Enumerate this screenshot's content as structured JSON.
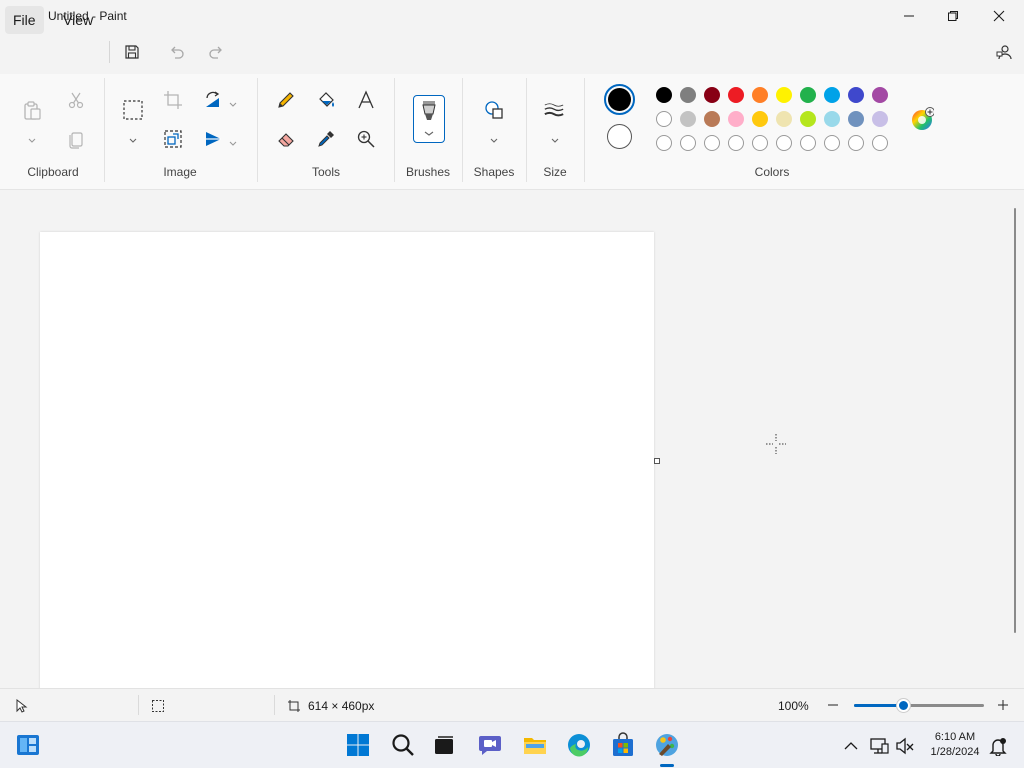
{
  "window": {
    "title": "Untitled - Paint"
  },
  "menu": {
    "file": "File",
    "view": "View"
  },
  "ribbon": {
    "groups": {
      "clipboard": "Clipboard",
      "image": "Image",
      "tools": "Tools",
      "brushes": "Brushes",
      "shapes": "Shapes",
      "size": "Size",
      "colors": "Colors"
    },
    "primary_color": "#000000",
    "secondary_color": "#ffffff",
    "palette_row1": [
      "#000000",
      "#7f7f7f",
      "#880015",
      "#ed1c24",
      "#ff7f27",
      "#fff200",
      "#22b14c",
      "#00a2e8",
      "#3f48cc",
      "#a349a4"
    ],
    "palette_row2": [
      "#ffffff",
      "#c3c3c3",
      "#b97a57",
      "#ffaec9",
      "#ffc90e",
      "#efe4b0",
      "#b5e61d",
      "#99d9ea",
      "#7092be",
      "#c8bfe7"
    ],
    "palette_row3_count": 10
  },
  "status": {
    "canvas_size": "614 × 460px",
    "zoom": "100%"
  },
  "taskbar": {
    "time": "6:10 AM",
    "date": "1/28/2024"
  }
}
